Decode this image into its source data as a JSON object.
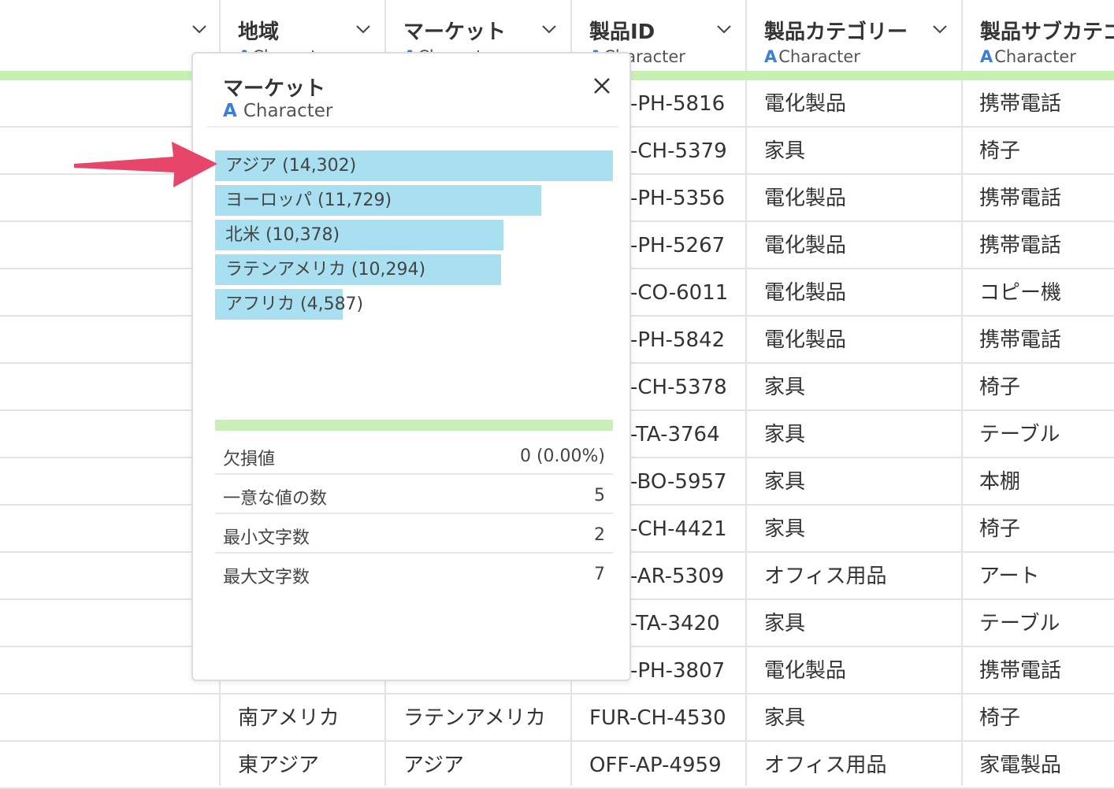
{
  "columns": [
    {
      "name": "",
      "type": ""
    },
    {
      "name": "地域",
      "type": "Character"
    },
    {
      "name": "マーケット",
      "type": "Character"
    },
    {
      "name": "製品ID",
      "type": "Character"
    },
    {
      "name": "製品カテゴリー",
      "type": "Character"
    },
    {
      "name": "製品サブカテゴ",
      "type": "Character"
    }
  ],
  "rows": [
    {
      "id": "-PH-5816",
      "category": "電化製品",
      "subcategory": "携帯電話"
    },
    {
      "id": "-CH-5379",
      "category": "家具",
      "subcategory": "椅子"
    },
    {
      "id": "-PH-5356",
      "category": "電化製品",
      "subcategory": "携帯電話"
    },
    {
      "id": "-PH-5267",
      "category": "電化製品",
      "subcategory": "携帯電話"
    },
    {
      "id": "-CO-6011",
      "category": "電化製品",
      "subcategory": "コピー機"
    },
    {
      "id": "-PH-5842",
      "category": "電化製品",
      "subcategory": "携帯電話"
    },
    {
      "id": "-CH-5378",
      "category": "家具",
      "subcategory": "椅子"
    },
    {
      "id": "-TA-3764",
      "category": "家具",
      "subcategory": "テーブル"
    },
    {
      "id": "-BO-5957",
      "category": "家具",
      "subcategory": "本棚"
    },
    {
      "id": "-CH-4421",
      "category": "家具",
      "subcategory": "椅子"
    },
    {
      "id": "-AR-5309",
      "category": "オフィス用品",
      "subcategory": "アート"
    },
    {
      "id": "-TA-3420",
      "category": "家具",
      "subcategory": "テーブル"
    },
    {
      "id": "-PH-3807",
      "category": "電化製品",
      "subcategory": "携帯電話"
    }
  ],
  "bottom_rows": [
    {
      "region": "南アメリカ",
      "market": "ラテンアメリカ",
      "id": "FUR-CH-4530",
      "category": "家具",
      "subcategory": "椅子"
    },
    {
      "region": "東アジア",
      "market": "アジア",
      "id": "OFF-AP-4959",
      "category": "オフィス用品",
      "subcategory": "家電製品"
    }
  ],
  "popup": {
    "title": "マーケット",
    "type_label": "Character",
    "type_icon": "A",
    "bars": [
      {
        "label": "アジア (14,302)",
        "count": 14302
      },
      {
        "label": "ヨーロッパ (11,729)",
        "count": 11729
      },
      {
        "label": "北米 (10,378)",
        "count": 10378
      },
      {
        "label": "ラテンアメリカ (10,294)",
        "count": 10294
      },
      {
        "label": "アフリカ (4,587)",
        "count": 4587
      }
    ],
    "stats": [
      {
        "label": "欠損値",
        "value": "0 (0.00%)"
      },
      {
        "label": "一意な値の数",
        "value": "5"
      },
      {
        "label": "最小文字数",
        "value": "2"
      },
      {
        "label": "最大文字数",
        "value": "7"
      }
    ]
  },
  "colors": {
    "bar": "#a8e0f1",
    "quality_bar": "#c8f0b6",
    "arrow": "#e8456b",
    "type_icon": "#3a7fd5"
  },
  "icons": {
    "column_menu": "chevron-down-icon",
    "close": "close-icon",
    "annotation": "arrow-icon"
  }
}
